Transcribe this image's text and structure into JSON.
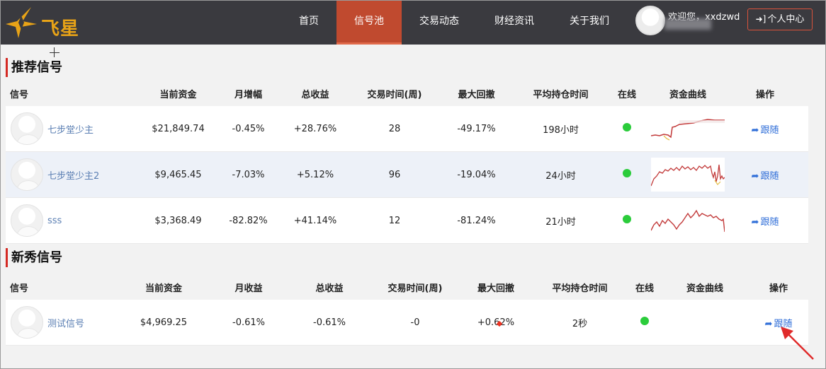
{
  "header": {
    "logo_text": "飞星",
    "nav": [
      "首页",
      "信号池",
      "交易动态",
      "财经资讯",
      "关于我们"
    ],
    "active_index": 1,
    "welcome": "欢迎您，xxdzwd",
    "user_center": "个人中心"
  },
  "recommended": {
    "title": "推荐信号",
    "columns": [
      "信号",
      "当前资金",
      "月增幅",
      "总收益",
      "交易时间(周)",
      "最大回撤",
      "平均持仓时间",
      "在线",
      "资金曲线",
      "操作"
    ],
    "rows": [
      {
        "name": "七步堂少主",
        "funds": "$21,849.74",
        "monthly": "-0.45%",
        "total": "+28.76%",
        "weeks": "28",
        "drawdown": "-49.17%",
        "hold": "198小时",
        "action": "跟随"
      },
      {
        "name": "七步堂少主2",
        "funds": "$9,465.45",
        "monthly": "-7.03%",
        "total": "+5.12%",
        "weeks": "96",
        "drawdown": "-19.04%",
        "hold": "24小时",
        "action": "跟随"
      },
      {
        "name": "sss",
        "funds": "$3,368.49",
        "monthly": "-82.82%",
        "total": "+41.14%",
        "weeks": "12",
        "drawdown": "-81.24%",
        "hold": "21小时",
        "action": "跟随"
      }
    ]
  },
  "newbie": {
    "title": "新秀信号",
    "columns": [
      "信号",
      "当前资金",
      "月收益",
      "总收益",
      "交易时间(周)",
      "最大回撤",
      "平均持仓时间",
      "在线",
      "资金曲线",
      "操作"
    ],
    "rows": [
      {
        "name": "测试信号",
        "funds": "$4,969.25",
        "monthly": "-0.61%",
        "total": "-0.61%",
        "weeks": "-0",
        "drawdown": "+0.62%",
        "hold": "2秒",
        "action": "跟随"
      }
    ]
  },
  "colors": {
    "topbar": "#3a3a3f",
    "active_nav": "#c04a2f",
    "accent_red": "#d42a24",
    "online": "#2bcc3b",
    "link": "#2f6ed8",
    "logo": "#e8a317"
  },
  "icons": {
    "follow": "share-arrow-icon",
    "user_center": "sign-in-icon",
    "online": "online-dot-icon"
  }
}
